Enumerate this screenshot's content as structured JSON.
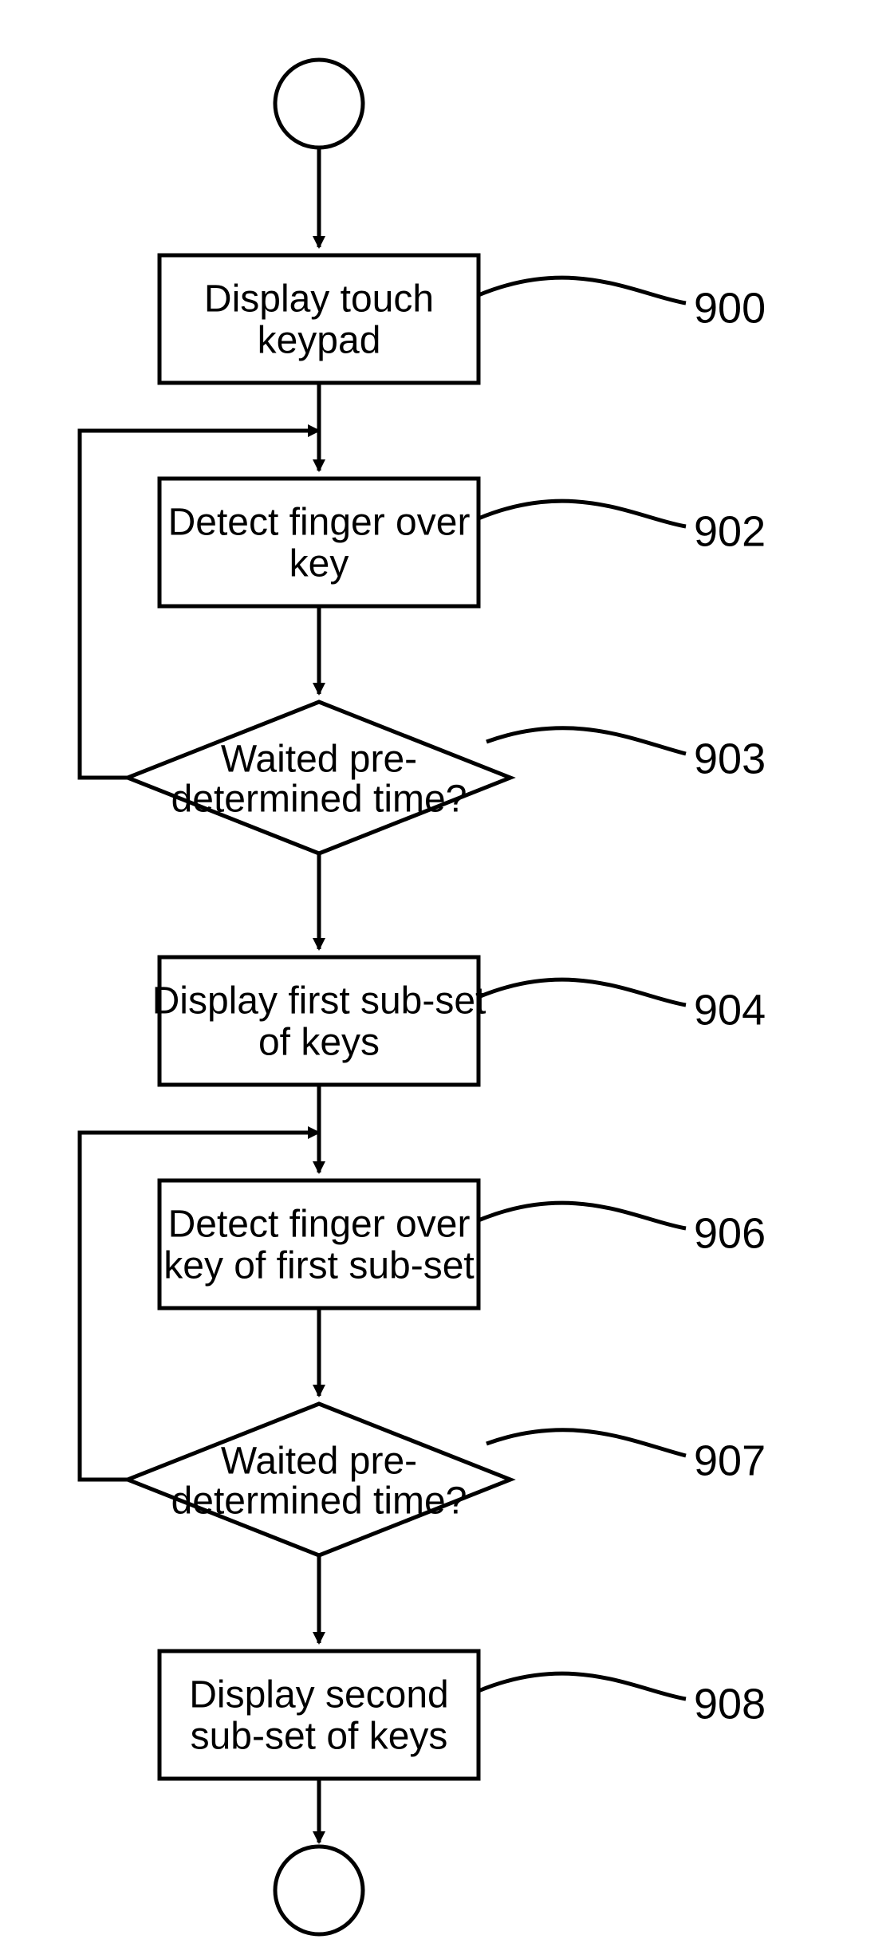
{
  "flowchart": {
    "type": "process_flowchart",
    "steps": {
      "900": {
        "label_l1": "Display touch",
        "label_l2": "keypad",
        "ref": "900",
        "shape": "process"
      },
      "902": {
        "label_l1": "Detect finger over",
        "label_l2": "key",
        "ref": "902",
        "shape": "process"
      },
      "903": {
        "label_l1": "Waited pre-",
        "label_l2": "determined time?",
        "ref": "903",
        "shape": "decision"
      },
      "904": {
        "label_l1": "Display first sub-set",
        "label_l2": "of keys",
        "ref": "904",
        "shape": "process"
      },
      "906": {
        "label_l1": "Detect finger over",
        "label_l2": "key of first sub-set",
        "ref": "906",
        "shape": "process"
      },
      "907": {
        "label_l1": "Waited pre-",
        "label_l2": "determined time?",
        "ref": "907",
        "shape": "decision"
      },
      "908": {
        "label_l1": "Display second",
        "label_l2": "sub-set of keys",
        "ref": "908",
        "shape": "process"
      }
    },
    "terminators": {
      "start": "circle",
      "end": "circle"
    },
    "feedback_loops": [
      {
        "from": "903_no",
        "to": "902"
      },
      {
        "from": "907_no",
        "to": "906"
      }
    ]
  }
}
